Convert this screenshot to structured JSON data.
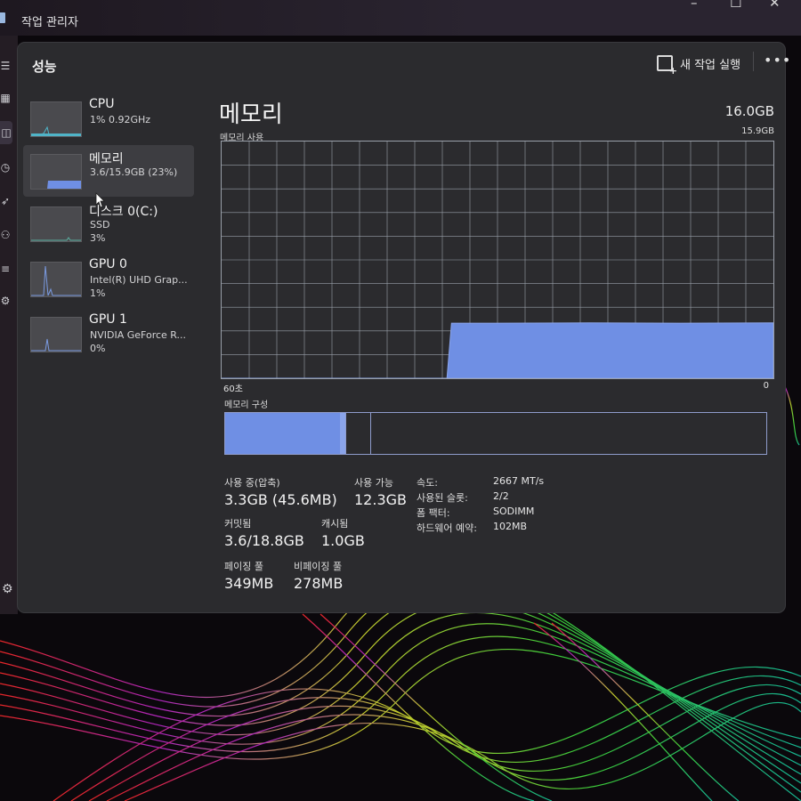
{
  "app": {
    "title": "작업 관리자"
  },
  "window_controls": [
    "–",
    "☐",
    "✕"
  ],
  "nav_icons": [
    "menu-icon",
    "processes-icon",
    "performance-icon",
    "history-icon",
    "startup-icon",
    "users-icon",
    "details-icon",
    "services-icon",
    "settings-icon"
  ],
  "header": {
    "title": "성능",
    "new_task": "새 작업 실행",
    "more": "•••"
  },
  "sidebar": {
    "items": [
      {
        "name": "CPU",
        "line1": "1% 0.92GHz",
        "line2": "",
        "graph_color": "#4fb4c8"
      },
      {
        "name": "메모리",
        "line1": "3.6/15.9GB (23%)",
        "line2": "",
        "graph_color": "#6f8fe4"
      },
      {
        "name": "디스크 0(C:)",
        "line1": "SSD",
        "line2": "3%",
        "graph_color": "#5ab0a0"
      },
      {
        "name": "GPU 0",
        "line1": "Intel(R) UHD Grap...",
        "line2": "1%",
        "graph_color": "#7a9ae0"
      },
      {
        "name": "GPU 1",
        "line1": "NVIDIA GeForce R...",
        "line2": "0%",
        "graph_color": "#7a9ae0"
      }
    ]
  },
  "main": {
    "title": "메모리",
    "total": "16.0GB",
    "usage_label": "메모리 사용",
    "usage_max": "15.9GB",
    "time_left": "60초",
    "time_right": "0",
    "composition_label": "메모리 구성",
    "usage_history": {
      "y_max": 15.9,
      "points": [
        [
          60,
          0
        ],
        [
          57,
          0
        ],
        [
          56,
          0
        ],
        [
          55,
          0
        ],
        [
          42,
          0
        ],
        [
          41,
          0
        ],
        [
          36,
          0
        ],
        [
          35.5,
          0
        ],
        [
          35,
          3.7
        ],
        [
          30,
          3.7
        ],
        [
          20,
          3.72
        ],
        [
          10,
          3.7
        ],
        [
          0,
          3.72
        ]
      ]
    },
    "composition": {
      "in_use_fraction": 0.222,
      "modified_fraction": 0.045
    }
  },
  "stats": {
    "in_use_label": "사용 중(압축)",
    "in_use_value": "3.3GB (45.6MB)",
    "available_label": "사용 가능",
    "available_value": "12.3GB",
    "committed_label": "커밋됨",
    "committed_value": "3.6/18.8GB",
    "cached_label": "캐시됨",
    "cached_value": "1.0GB",
    "paged_label": "페이징 풀",
    "paged_value": "349MB",
    "nonpaged_label": "비페이징 풀",
    "nonpaged_value": "278MB"
  },
  "details": [
    {
      "key": "속도:",
      "value": "2667 MT/s"
    },
    {
      "key": "사용된 슬롯:",
      "value": "2/2"
    },
    {
      "key": "폼 팩터:",
      "value": "SODIMM"
    },
    {
      "key": "하드웨어 예약:",
      "value": "102MB"
    }
  ],
  "colors": {
    "accent": "#6f8fe4",
    "panel": "#2b2b2e",
    "grid": "#9aa0aa"
  }
}
